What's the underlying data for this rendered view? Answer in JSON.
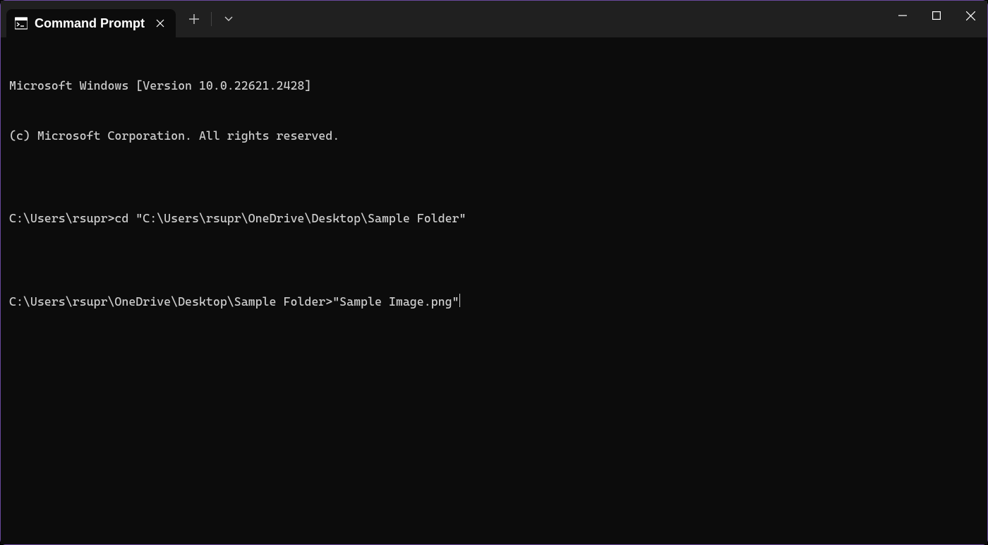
{
  "titlebar": {
    "tab_title": "Command Prompt"
  },
  "terminal": {
    "line1": "Microsoft Windows [Version 10.0.22621.2428]",
    "line2": "(c) Microsoft Corporation. All rights reserved.",
    "blank1": "",
    "prompt1": "C:\\Users\\rsupr>",
    "command1": "cd \"C:\\Users\\rsupr\\OneDrive\\Desktop\\Sample Folder\"",
    "blank2": "",
    "prompt2": "C:\\Users\\rsupr\\OneDrive\\Desktop\\Sample Folder>",
    "command2": "\"Sample Image.png\""
  }
}
